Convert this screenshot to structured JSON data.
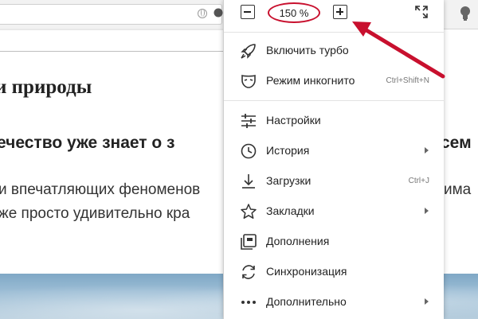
{
  "page": {
    "title": "и природы",
    "subtitle": "ечество уже знает о з",
    "subtitle_right": "сем",
    "paragraph_line1": "и впечатляющих феноменов",
    "paragraph_line1_right": "има",
    "paragraph_line2": "же просто удивительно кра"
  },
  "menu": {
    "zoom_value": "150 %",
    "items": [
      {
        "label": "Включить турбо",
        "icon": "rocket-icon"
      },
      {
        "label": "Режим инкогнито",
        "shortcut": "Ctrl+Shift+N",
        "icon": "incognito-mask-icon"
      },
      {
        "label": "Настройки",
        "icon": "settings-sliders-icon"
      },
      {
        "label": "История",
        "icon": "history-clock-icon",
        "submenu": true
      },
      {
        "label": "Загрузки",
        "shortcut": "Ctrl+J",
        "icon": "download-icon"
      },
      {
        "label": "Закладки",
        "icon": "star-icon",
        "submenu": true
      },
      {
        "label": "Дополнения",
        "icon": "extensions-icon"
      },
      {
        "label": "Синхронизация",
        "icon": "sync-icon"
      },
      {
        "label": "Дополнительно",
        "icon": "more-dots-icon",
        "submenu": true
      }
    ]
  },
  "colors": {
    "annotation": "#c8102e",
    "menu_background": "#ffffff",
    "text": "#222222"
  }
}
